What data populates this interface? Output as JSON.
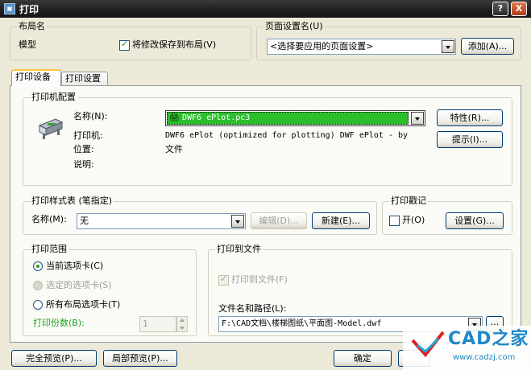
{
  "window": {
    "title": "打印",
    "help_btn": "?",
    "close_btn": "X"
  },
  "layout_name": {
    "group_label": "布局名",
    "value": "模型",
    "save_checkbox_label": "将修改保存到布局(V)"
  },
  "page_setup": {
    "group_label": "页面设置名(U)",
    "combo_value": "<选择要应用的页面设置>",
    "add_button": "添加(A)..."
  },
  "tabs": [
    {
      "label": "打印设备"
    },
    {
      "label": "打印设置"
    }
  ],
  "plotter": {
    "group_label": "打印机配置",
    "name_label": "名称(N):",
    "name_value": "DWF6 ePlot.pc3",
    "properties_button": "特性(R)...",
    "plotter_label": "打印机:",
    "plotter_value": "DWF6 ePlot (optimized for plotting) DWF ePlot - by",
    "location_label": "位置:",
    "location_value": "文件",
    "description_label": "说明:",
    "hints_button": "提示(I)..."
  },
  "plot_style": {
    "group_label": "打印样式表 (笔指定)",
    "name_label": "名称(M):",
    "name_value": "无",
    "edit_button": "编辑(D)...",
    "new_button": "新建(E)..."
  },
  "plot_stamp": {
    "group_label": "打印戳记",
    "on_label": "开(O)",
    "settings_button": "设置(G)..."
  },
  "plot_range": {
    "group_label": "打印范围",
    "current_tab": "当前选项卡(C)",
    "selected_tabs": "选定的选项卡(S)",
    "all_layout_tabs": "所有布局选项卡(T)",
    "copies_label": "打印份数(B):",
    "copies_value": "1"
  },
  "plot_to_file": {
    "group_label": "打印到文件",
    "checkbox_label": "打印到文件(F)",
    "path_label": "文件名和路径(L):",
    "path_value": "F:\\CAD文档\\楼梯图纸\\平面图-Model.dwf",
    "browse_button": "..."
  },
  "footer": {
    "full_preview": "完全预览(P)...",
    "partial_preview": "局部预览(P)...",
    "ok": "确定",
    "watermark_brand": "CAD之家",
    "watermark_url": "www.cadzj.com"
  }
}
